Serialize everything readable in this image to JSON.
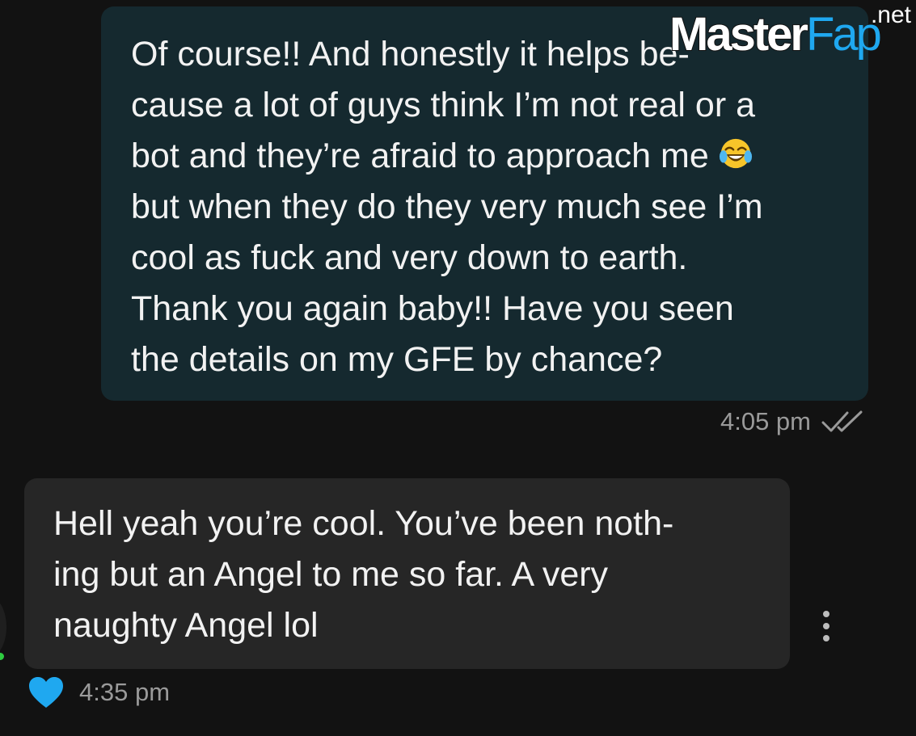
{
  "conversation": {
    "outgoing": {
      "lines": [
        "Of course!! And honestly it helps be-",
        "cause a lot of guys think I’m not real or a",
        "bot and they’re afraid to approach me",
        "but when they do they very much see I’m",
        "cool as fuck and very down to earth.",
        "Thank you again baby!! Have you seen",
        "the details on my GFE by chance?"
      ],
      "emoji": "face-with-tears-of-joy-icon",
      "time": "4:05 pm",
      "status_icon": "double-check-icon"
    },
    "incoming": {
      "lines": [
        "Hell yeah you’re cool. You’ve been noth-",
        "ing but an Angel to me so far. A very",
        "naughty Angel lol"
      ],
      "time": "4:35 pm",
      "reaction_icon": "heart-icon"
    }
  },
  "watermark": {
    "master": "Master",
    "fap": "Fap",
    "net": ".net"
  },
  "colors": {
    "background": "#121212",
    "outgoing_bubble": "#15292f",
    "incoming_bubble": "#262626",
    "text": "#f2f2f2",
    "meta_text": "#9a9a9a",
    "heart": "#1fa8f0",
    "online": "#2ecc40"
  }
}
